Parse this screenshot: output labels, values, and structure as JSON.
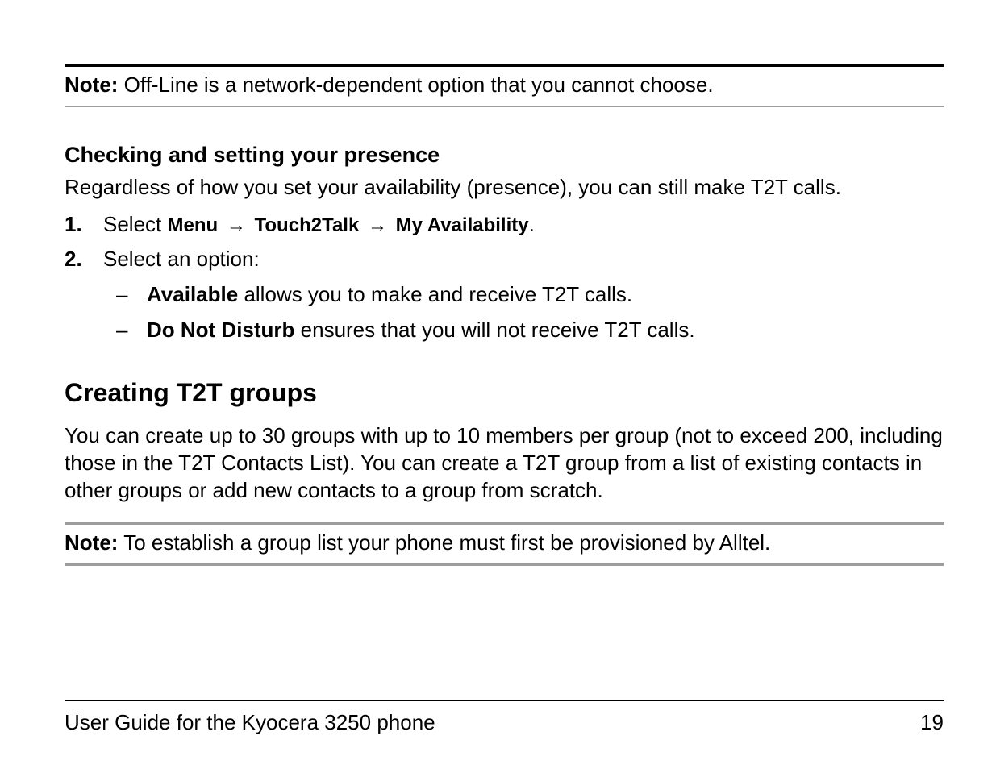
{
  "note1": {
    "label": "Note:",
    "text": " Off-Line is a network-dependent option that you cannot choose."
  },
  "section1": {
    "heading": "Checking and setting your presence",
    "paragraph": "Regardless of how you set your availability (presence), you can still make T2T calls.",
    "steps": [
      {
        "number": "1.",
        "prefix": "Select ",
        "menu1": "Menu",
        "arrow": " → ",
        "menu2": "Touch2Talk",
        "menu3": "My Availability",
        "suffix": "."
      },
      {
        "number": "2.",
        "text": "Select an option:",
        "subitems": [
          {
            "dash": "–",
            "bold": "Available",
            "rest": " allows you to make and receive T2T calls."
          },
          {
            "dash": "–",
            "bold": "Do Not Disturb",
            "rest": " ensures that you will not receive T2T calls."
          }
        ]
      }
    ]
  },
  "section2": {
    "heading": "Creating T2T groups",
    "paragraph": "You can create up to 30 groups with up to 10 members per group (not to exceed 200, including those in the T2T Contacts List). You can create a T2T group from a list of existing contacts in other groups or add new contacts to a group from scratch."
  },
  "note2": {
    "label": "Note:",
    "text": " To establish a group list your phone must first be provisioned by Alltel."
  },
  "footer": {
    "title": "User Guide for the Kyocera 3250 phone",
    "page": "19"
  }
}
